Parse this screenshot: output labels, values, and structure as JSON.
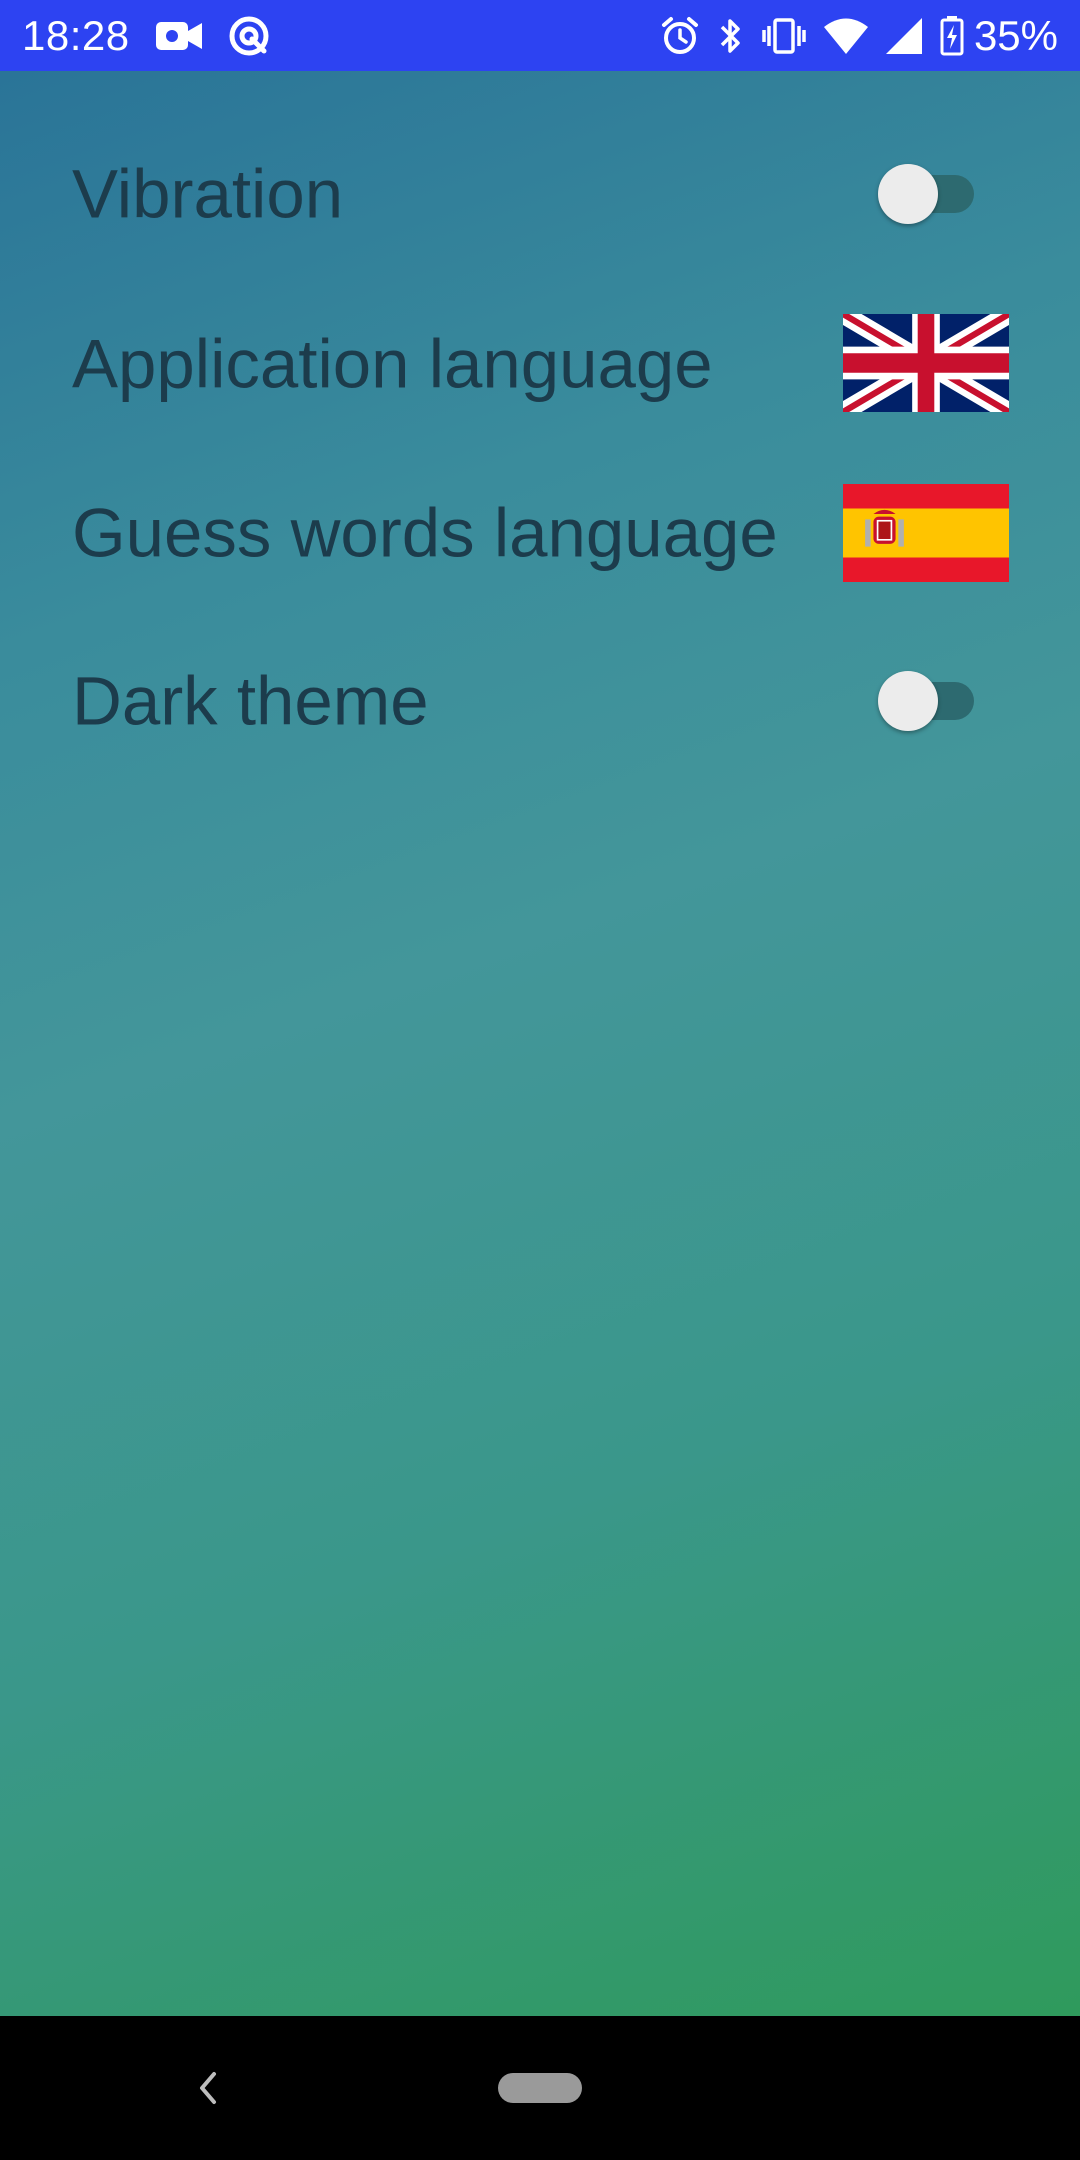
{
  "status_bar": {
    "time": "18:28",
    "battery": "35%",
    "icons_left": [
      "video-camera-icon",
      "data-saver-icon"
    ],
    "icons_right": [
      "alarm-icon",
      "bluetooth-icon",
      "vibrate-icon",
      "wifi-icon",
      "cell-signal-icon",
      "battery-charging-icon"
    ],
    "color": "#2d43f2"
  },
  "settings": {
    "vibration": {
      "label": "Vibration",
      "enabled": false
    },
    "app_language": {
      "label": "Application language",
      "flag": "uk-flag-icon"
    },
    "guess_language": {
      "label": "Guess words language",
      "flag": "spain-flag-icon"
    },
    "dark_theme": {
      "label": "Dark theme",
      "enabled": false
    }
  },
  "colors": {
    "label_text": "#1c3c4c",
    "gradient_top": "#2a7498",
    "gradient_bottom": "#2f9a5c"
  },
  "nav_bar": {
    "icons": [
      "back-icon",
      "home-pill-icon"
    ]
  }
}
